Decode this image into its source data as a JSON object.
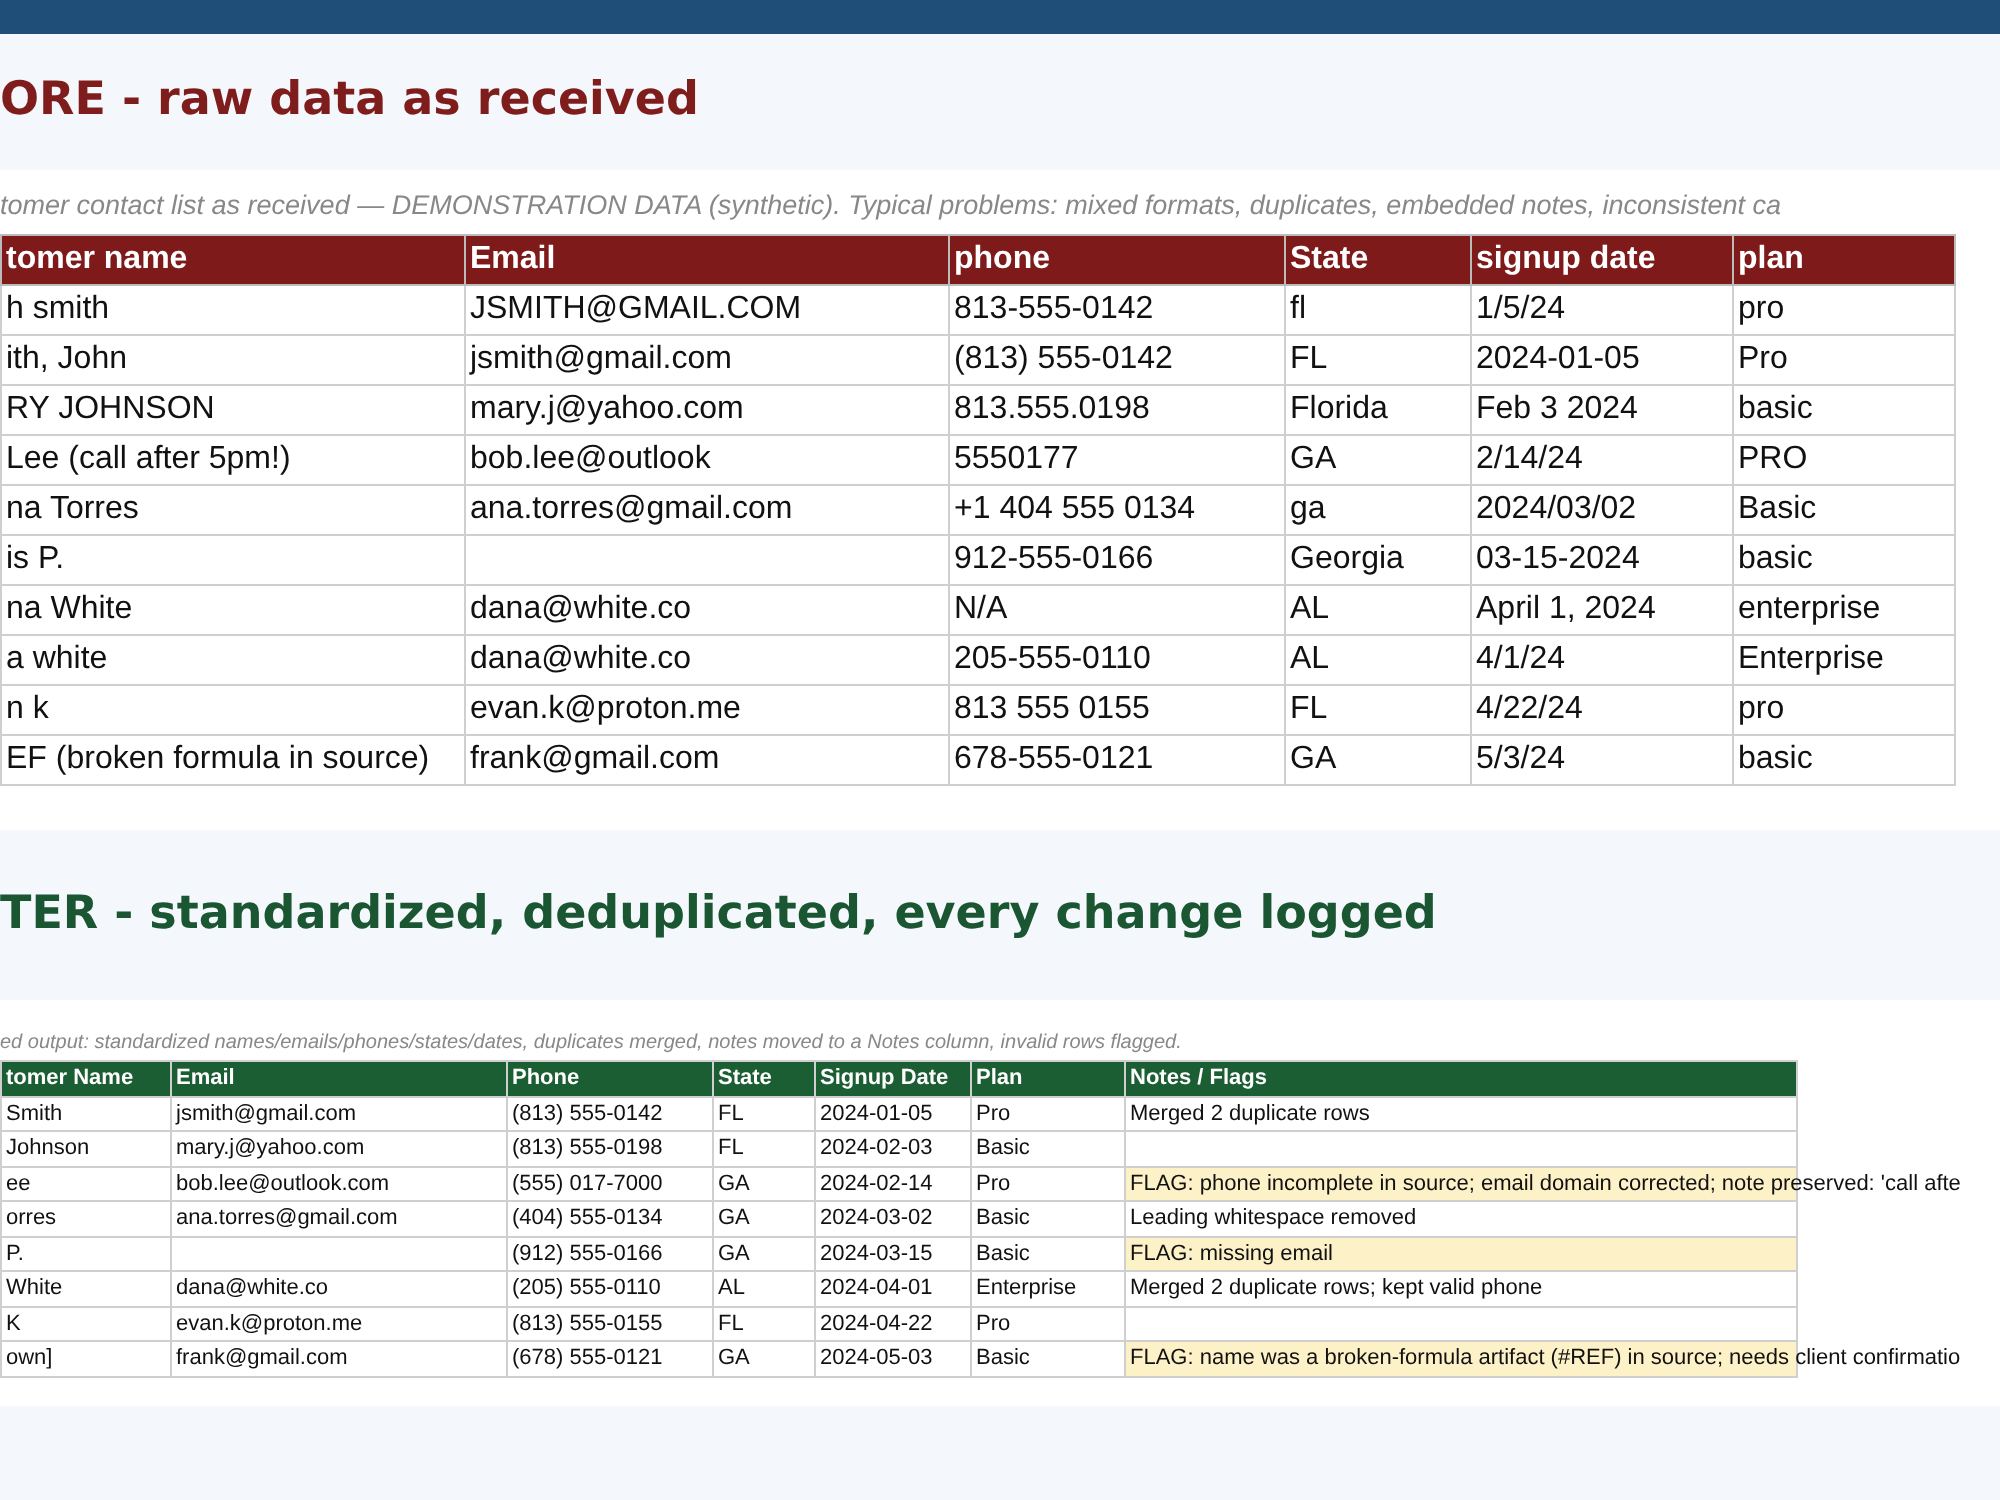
{
  "before": {
    "heading": "ORE - raw data as received",
    "caption": "tomer contact list as received — DEMONSTRATION DATA (synthetic). Typical problems: mixed formats, duplicates, embedded notes, inconsistent ca",
    "columns": [
      "tomer name",
      "Email",
      "phone",
      "State",
      "signup date",
      "plan"
    ],
    "rows": [
      [
        "h smith",
        "JSMITH@GMAIL.COM",
        "813-555-0142",
        "fl",
        "1/5/24",
        "pro"
      ],
      [
        "ith, John",
        "jsmith@gmail.com",
        "(813) 555-0142",
        "FL",
        "2024-01-05",
        "Pro"
      ],
      [
        "RY JOHNSON",
        "mary.j@yahoo.com",
        "813.555.0198",
        "Florida",
        "Feb 3 2024",
        "basic"
      ],
      [
        "Lee (call after 5pm!)",
        "bob.lee@outlook",
        "5550177",
        "GA",
        "2/14/24",
        "PRO"
      ],
      [
        "na Torres",
        "ana.torres@gmail.com",
        "+1 404 555 0134",
        "ga",
        "2024/03/02",
        "Basic"
      ],
      [
        "is P.",
        "",
        "912-555-0166",
        "Georgia",
        "03-15-2024",
        "basic"
      ],
      [
        "na White",
        "dana@white.co",
        "N/A",
        "AL",
        "April 1, 2024",
        "enterprise"
      ],
      [
        "a white",
        "dana@white.co",
        "205-555-0110",
        "AL",
        "4/1/24",
        "Enterprise"
      ],
      [
        "n k",
        "evan.k@proton.me",
        "813 555 0155",
        "FL",
        "4/22/24",
        "pro"
      ],
      [
        "EF (broken formula in source)",
        "frank@gmail.com",
        "678-555-0121",
        "GA",
        "5/3/24",
        "basic"
      ]
    ]
  },
  "after": {
    "heading": "TER - standardized, deduplicated, every change logged",
    "caption": "ed output: standardized names/emails/phones/states/dates, duplicates merged, notes moved to a Notes column, invalid rows flagged.",
    "columns": [
      "tomer Name",
      "Email",
      "Phone",
      "State",
      "Signup Date",
      "Plan",
      "Notes / Flags"
    ],
    "rows": [
      {
        "cells": [
          "Smith",
          "jsmith@gmail.com",
          "(813) 555-0142",
          "FL",
          "2024-01-05",
          "Pro",
          "Merged 2 duplicate rows"
        ],
        "flag": false
      },
      {
        "cells": [
          "Johnson",
          "mary.j@yahoo.com",
          "(813) 555-0198",
          "FL",
          "2024-02-03",
          "Basic",
          ""
        ],
        "flag": false
      },
      {
        "cells": [
          "ee",
          "bob.lee@outlook.com",
          "(555) 017-7000",
          "GA",
          "2024-02-14",
          "Pro",
          "FLAG: phone incomplete in source; email domain corrected; note preserved: 'call afte"
        ],
        "flag": true
      },
      {
        "cells": [
          "orres",
          "ana.torres@gmail.com",
          "(404) 555-0134",
          "GA",
          "2024-03-02",
          "Basic",
          "Leading whitespace removed"
        ],
        "flag": false
      },
      {
        "cells": [
          "P.",
          "",
          "(912) 555-0166",
          "GA",
          "2024-03-15",
          "Basic",
          "FLAG: missing email"
        ],
        "flag": true
      },
      {
        "cells": [
          "White",
          "dana@white.co",
          "(205) 555-0110",
          "AL",
          "2024-04-01",
          "Enterprise",
          "Merged 2 duplicate rows; kept valid phone"
        ],
        "flag": false
      },
      {
        "cells": [
          "K",
          "evan.k@proton.me",
          "(813) 555-0155",
          "FL",
          "2024-04-22",
          "Pro",
          ""
        ],
        "flag": false
      },
      {
        "cells": [
          "own]",
          "frank@gmail.com",
          "(678) 555-0121",
          "GA",
          "2024-05-03",
          "Basic",
          "FLAG: name was a broken-formula artifact (#REF) in source; needs client confirmatio"
        ],
        "flag": true
      }
    ]
  }
}
